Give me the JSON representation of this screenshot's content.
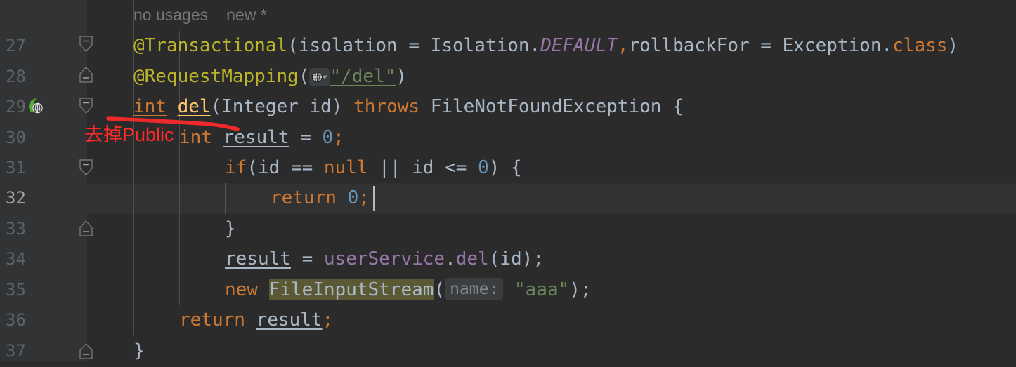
{
  "app": {
    "type": "code-editor",
    "theme": "darcula",
    "background": "#2b2b2b",
    "gutter_background": "#313335",
    "current_line_background": "#323232"
  },
  "code_vision": {
    "usages_label": "no usages",
    "authors_label": "new *"
  },
  "gutter": {
    "line_numbers": [
      "27",
      "28",
      "29",
      "30",
      "31",
      "32",
      "33",
      "34",
      "35",
      "36",
      "37"
    ],
    "active_line": "32",
    "icons": [
      {
        "line": "29",
        "name": "spring-mvc-request-mapping-icon",
        "color": "#5aa832"
      }
    ],
    "fold_markers": [
      {
        "line": "27",
        "type": "collapse-down"
      },
      {
        "line": "28",
        "type": "collapse-up"
      },
      {
        "line": "29",
        "type": "collapse-down"
      },
      {
        "line": "31",
        "type": "collapse-down"
      },
      {
        "line": "33",
        "type": "collapse-up"
      },
      {
        "line": "37",
        "type": "collapse-up"
      }
    ]
  },
  "editor": {
    "caret_line": "32",
    "caret_column_after": "return 0;",
    "lines": [
      {
        "number": "27",
        "text": "@Transactional(isolation = Isolation.DEFAULT,rollbackFor = Exception.class)",
        "tokens": [
          {
            "t": "@Transactional",
            "c": "anno"
          },
          {
            "t": "(",
            "c": "plain"
          },
          {
            "t": "isolation",
            "c": "ident"
          },
          {
            "t": " = ",
            "c": "plain"
          },
          {
            "t": "Isolation.",
            "c": "ident"
          },
          {
            "t": "DEFAULT",
            "c": "static"
          },
          {
            "t": ",",
            "c": "comma"
          },
          {
            "t": "rollbackFor",
            "c": "ident"
          },
          {
            "t": " = ",
            "c": "plain"
          },
          {
            "t": "Exception.",
            "c": "ident"
          },
          {
            "t": "class",
            "c": "kw"
          },
          {
            "t": ")",
            "c": "plain"
          }
        ]
      },
      {
        "number": "28",
        "text": "@RequestMapping(\"/del\")",
        "has_globe_icon": true,
        "tokens": [
          {
            "t": "@RequestMapping",
            "c": "anno"
          },
          {
            "t": "(",
            "c": "plain"
          },
          {
            "t": "\"/del\"",
            "c": "str"
          },
          {
            "t": ")",
            "c": "plain"
          }
        ]
      },
      {
        "number": "29",
        "text": "int del(Integer id) throws FileNotFoundException {",
        "tokens": [
          {
            "t": "int",
            "c": "kw"
          },
          {
            "t": " ",
            "c": "plain"
          },
          {
            "t": "del",
            "c": "method"
          },
          {
            "t": "(",
            "c": "plain"
          },
          {
            "t": "Integer",
            "c": "ident"
          },
          {
            "t": " ",
            "c": "plain"
          },
          {
            "t": "id",
            "c": "ident"
          },
          {
            "t": ")",
            "c": "plain"
          },
          {
            "t": " ",
            "c": "plain"
          },
          {
            "t": "throws",
            "c": "kw"
          },
          {
            "t": " ",
            "c": "plain"
          },
          {
            "t": "FileNotFoundException",
            "c": "ident"
          },
          {
            "t": " {",
            "c": "plain"
          }
        ]
      },
      {
        "number": "30",
        "text": "int result = 0;",
        "tokens": [
          {
            "t": "int",
            "c": "kw"
          },
          {
            "t": " ",
            "c": "plain"
          },
          {
            "t": "result",
            "c": "ident-u"
          },
          {
            "t": " = ",
            "c": "plain"
          },
          {
            "t": "0",
            "c": "num"
          },
          {
            "t": ";",
            "c": "comma"
          }
        ]
      },
      {
        "number": "31",
        "text": "if(id == null || id <= 0) {",
        "tokens": [
          {
            "t": "if",
            "c": "kw"
          },
          {
            "t": "(",
            "c": "plain"
          },
          {
            "t": "id",
            "c": "ident"
          },
          {
            "t": " == ",
            "c": "plain"
          },
          {
            "t": "null",
            "c": "kw"
          },
          {
            "t": " || ",
            "c": "plain"
          },
          {
            "t": "id",
            "c": "ident"
          },
          {
            "t": " <= ",
            "c": "plain"
          },
          {
            "t": "0",
            "c": "num"
          },
          {
            "t": ") {",
            "c": "plain"
          }
        ]
      },
      {
        "number": "32",
        "text": "return 0;",
        "current": true,
        "tokens": [
          {
            "t": "return",
            "c": "kw"
          },
          {
            "t": " ",
            "c": "plain"
          },
          {
            "t": "0",
            "c": "num"
          },
          {
            "t": ";",
            "c": "comma"
          }
        ]
      },
      {
        "number": "33",
        "text": "}",
        "tokens": [
          {
            "t": "}",
            "c": "plain"
          }
        ]
      },
      {
        "number": "34",
        "text": "result = userService.del(id);",
        "tokens": [
          {
            "t": "result",
            "c": "ident-u"
          },
          {
            "t": " = ",
            "c": "plain"
          },
          {
            "t": "userService",
            "c": "field"
          },
          {
            "t": ".",
            "c": "plain"
          },
          {
            "t": "del",
            "c": "field"
          },
          {
            "t": "(",
            "c": "plain"
          },
          {
            "t": "id",
            "c": "ident"
          },
          {
            "t": ");",
            "c": "plain"
          }
        ]
      },
      {
        "number": "35",
        "text": "new FileInputStream( name: \"aaa\");",
        "inlay_hint": "name:",
        "tokens": [
          {
            "t": "new",
            "c": "kw"
          },
          {
            "t": " ",
            "c": "plain"
          },
          {
            "t": "FileInputStream",
            "c": "hl-ident"
          },
          {
            "t": "(",
            "c": "plain"
          },
          {
            "t": "\"aaa\"",
            "c": "str"
          },
          {
            "t": ");",
            "c": "plain"
          }
        ]
      },
      {
        "number": "36",
        "text": "return result;",
        "tokens": [
          {
            "t": "return",
            "c": "kw"
          },
          {
            "t": " ",
            "c": "plain"
          },
          {
            "t": "result",
            "c": "ident-u"
          },
          {
            "t": ";",
            "c": "comma"
          }
        ]
      },
      {
        "number": "37",
        "text": "}",
        "tokens": [
          {
            "t": "}",
            "c": "plain"
          }
        ]
      }
    ]
  },
  "annotations": [
    {
      "name": "red-underline-stroke",
      "kind": "freehand-line",
      "color": "#ef2a2a",
      "target_line": "29",
      "target_text": "int del("
    },
    {
      "name": "red-note-text",
      "kind": "text",
      "color": "#ff2a2a",
      "text": "去掉Public",
      "target_line": "30"
    }
  ],
  "colors": {
    "keyword": "#cc7832",
    "annotation": "#bbb529",
    "string": "#6a8759",
    "number": "#6897bb",
    "field": "#9876aa",
    "method": "#ffc66d",
    "identifier": "#a9b7c6",
    "highlight": "#5b5834",
    "inlay": "#868a8c",
    "line_number": "#606366",
    "annotation_red": "#ff2a2a"
  }
}
